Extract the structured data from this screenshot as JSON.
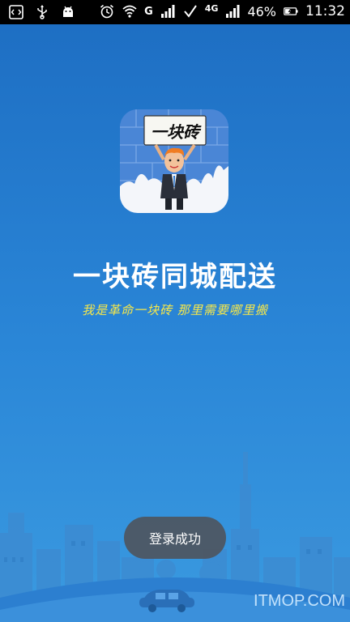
{
  "status_bar": {
    "left_icons": [
      "code-icon",
      "usb-icon",
      "android-icon"
    ],
    "right_icons": [
      "alarm-icon",
      "wifi-icon",
      "g-network-icon",
      "signal-icon",
      "check-icon",
      "4g-icon",
      "signal-icon-2",
      "battery-icon"
    ],
    "network_label": "G",
    "network_4g_label": "4G",
    "battery_percent": "46%",
    "time": "11:32"
  },
  "app": {
    "icon_sign_text": "一块砖",
    "title": "一块砖同城配送",
    "slogan": "我是革命一块砖  那里需要哪里搬"
  },
  "toast": {
    "message": "登录成功"
  },
  "watermark": "ITMOP.COM",
  "colors": {
    "background_top": "#1d6dc2",
    "background_bottom": "#3a9ae0",
    "slogan": "#f6e74a",
    "toast": "#505055"
  }
}
